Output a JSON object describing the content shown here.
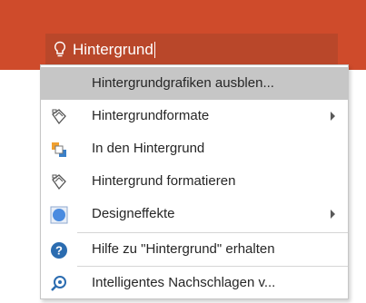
{
  "search": {
    "query": "Hintergrund",
    "icon": "lightbulb-icon"
  },
  "menu": {
    "items": [
      {
        "label": "Hintergrundgrafiken ausblen...",
        "icon": "none",
        "submenu": false,
        "highlighted": true
      },
      {
        "label": "Hintergrundformate",
        "icon": "paint-bucket-icon",
        "submenu": true,
        "highlighted": false
      },
      {
        "label": "In den Hintergrund",
        "icon": "send-to-back-icon",
        "submenu": false,
        "highlighted": false
      },
      {
        "label": "Hintergrund formatieren",
        "icon": "paint-bucket-icon",
        "submenu": false,
        "highlighted": false
      },
      {
        "label": "Designeffekte",
        "icon": "design-effects-icon",
        "submenu": true,
        "highlighted": false
      },
      {
        "label": "Hilfe zu \"Hintergrund\" erhalten",
        "icon": "help-icon",
        "submenu": false,
        "highlighted": false
      },
      {
        "label": "Intelligentes Nachschlagen v...",
        "icon": "smart-lookup-icon",
        "submenu": false,
        "highlighted": false
      }
    ]
  },
  "colors": {
    "ribbon": "#cf4b2b",
    "search_box": "#b9472a",
    "highlight": "#c6c6c6",
    "help_icon": "#2b6cb0"
  }
}
